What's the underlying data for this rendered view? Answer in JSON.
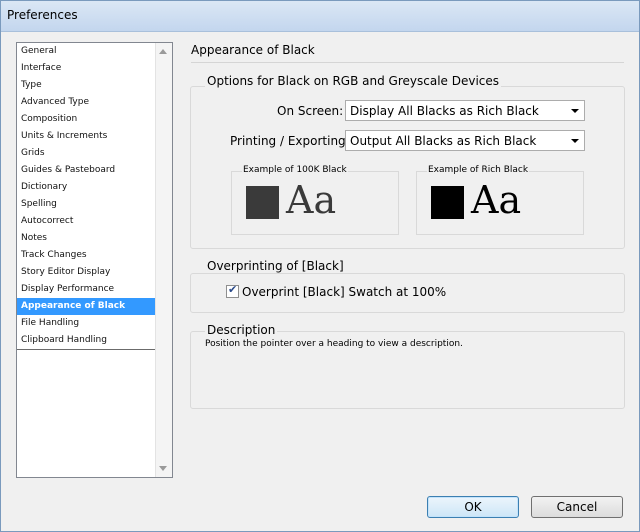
{
  "window": {
    "title": "Preferences"
  },
  "categories": [
    "General",
    "Interface",
    "Type",
    "Advanced Type",
    "Composition",
    "Units & Increments",
    "Grids",
    "Guides & Pasteboard",
    "Dictionary",
    "Spelling",
    "Autocorrect",
    "Notes",
    "Track Changes",
    "Story Editor Display",
    "Display Performance",
    "Appearance of Black",
    "File Handling",
    "Clipboard Handling"
  ],
  "selected_category": "Appearance of Black",
  "panel": {
    "title": "Appearance of Black",
    "options_group": {
      "title": "Options for Black on RGB and Greyscale Devices",
      "on_screen_label": "On Screen:",
      "on_screen_value": "Display All Blacks as Rich Black",
      "printing_label": "Printing / Exporting:",
      "printing_value": "Output All Blacks as Rich Black",
      "example_100k_label": "Example of 100K Black",
      "example_rich_label": "Example of Rich Black",
      "example_text": "Aa",
      "color_100k": "#3a3a3a",
      "color_rich": "#000000"
    },
    "overprint_group": {
      "title": "Overprinting of [Black]",
      "checkbox_label": "Overprint [Black] Swatch at 100%",
      "checked": true
    },
    "description_group": {
      "title": "Description",
      "text": "Position the pointer over a heading to view a description."
    }
  },
  "buttons": {
    "ok": "OK",
    "cancel": "Cancel"
  }
}
